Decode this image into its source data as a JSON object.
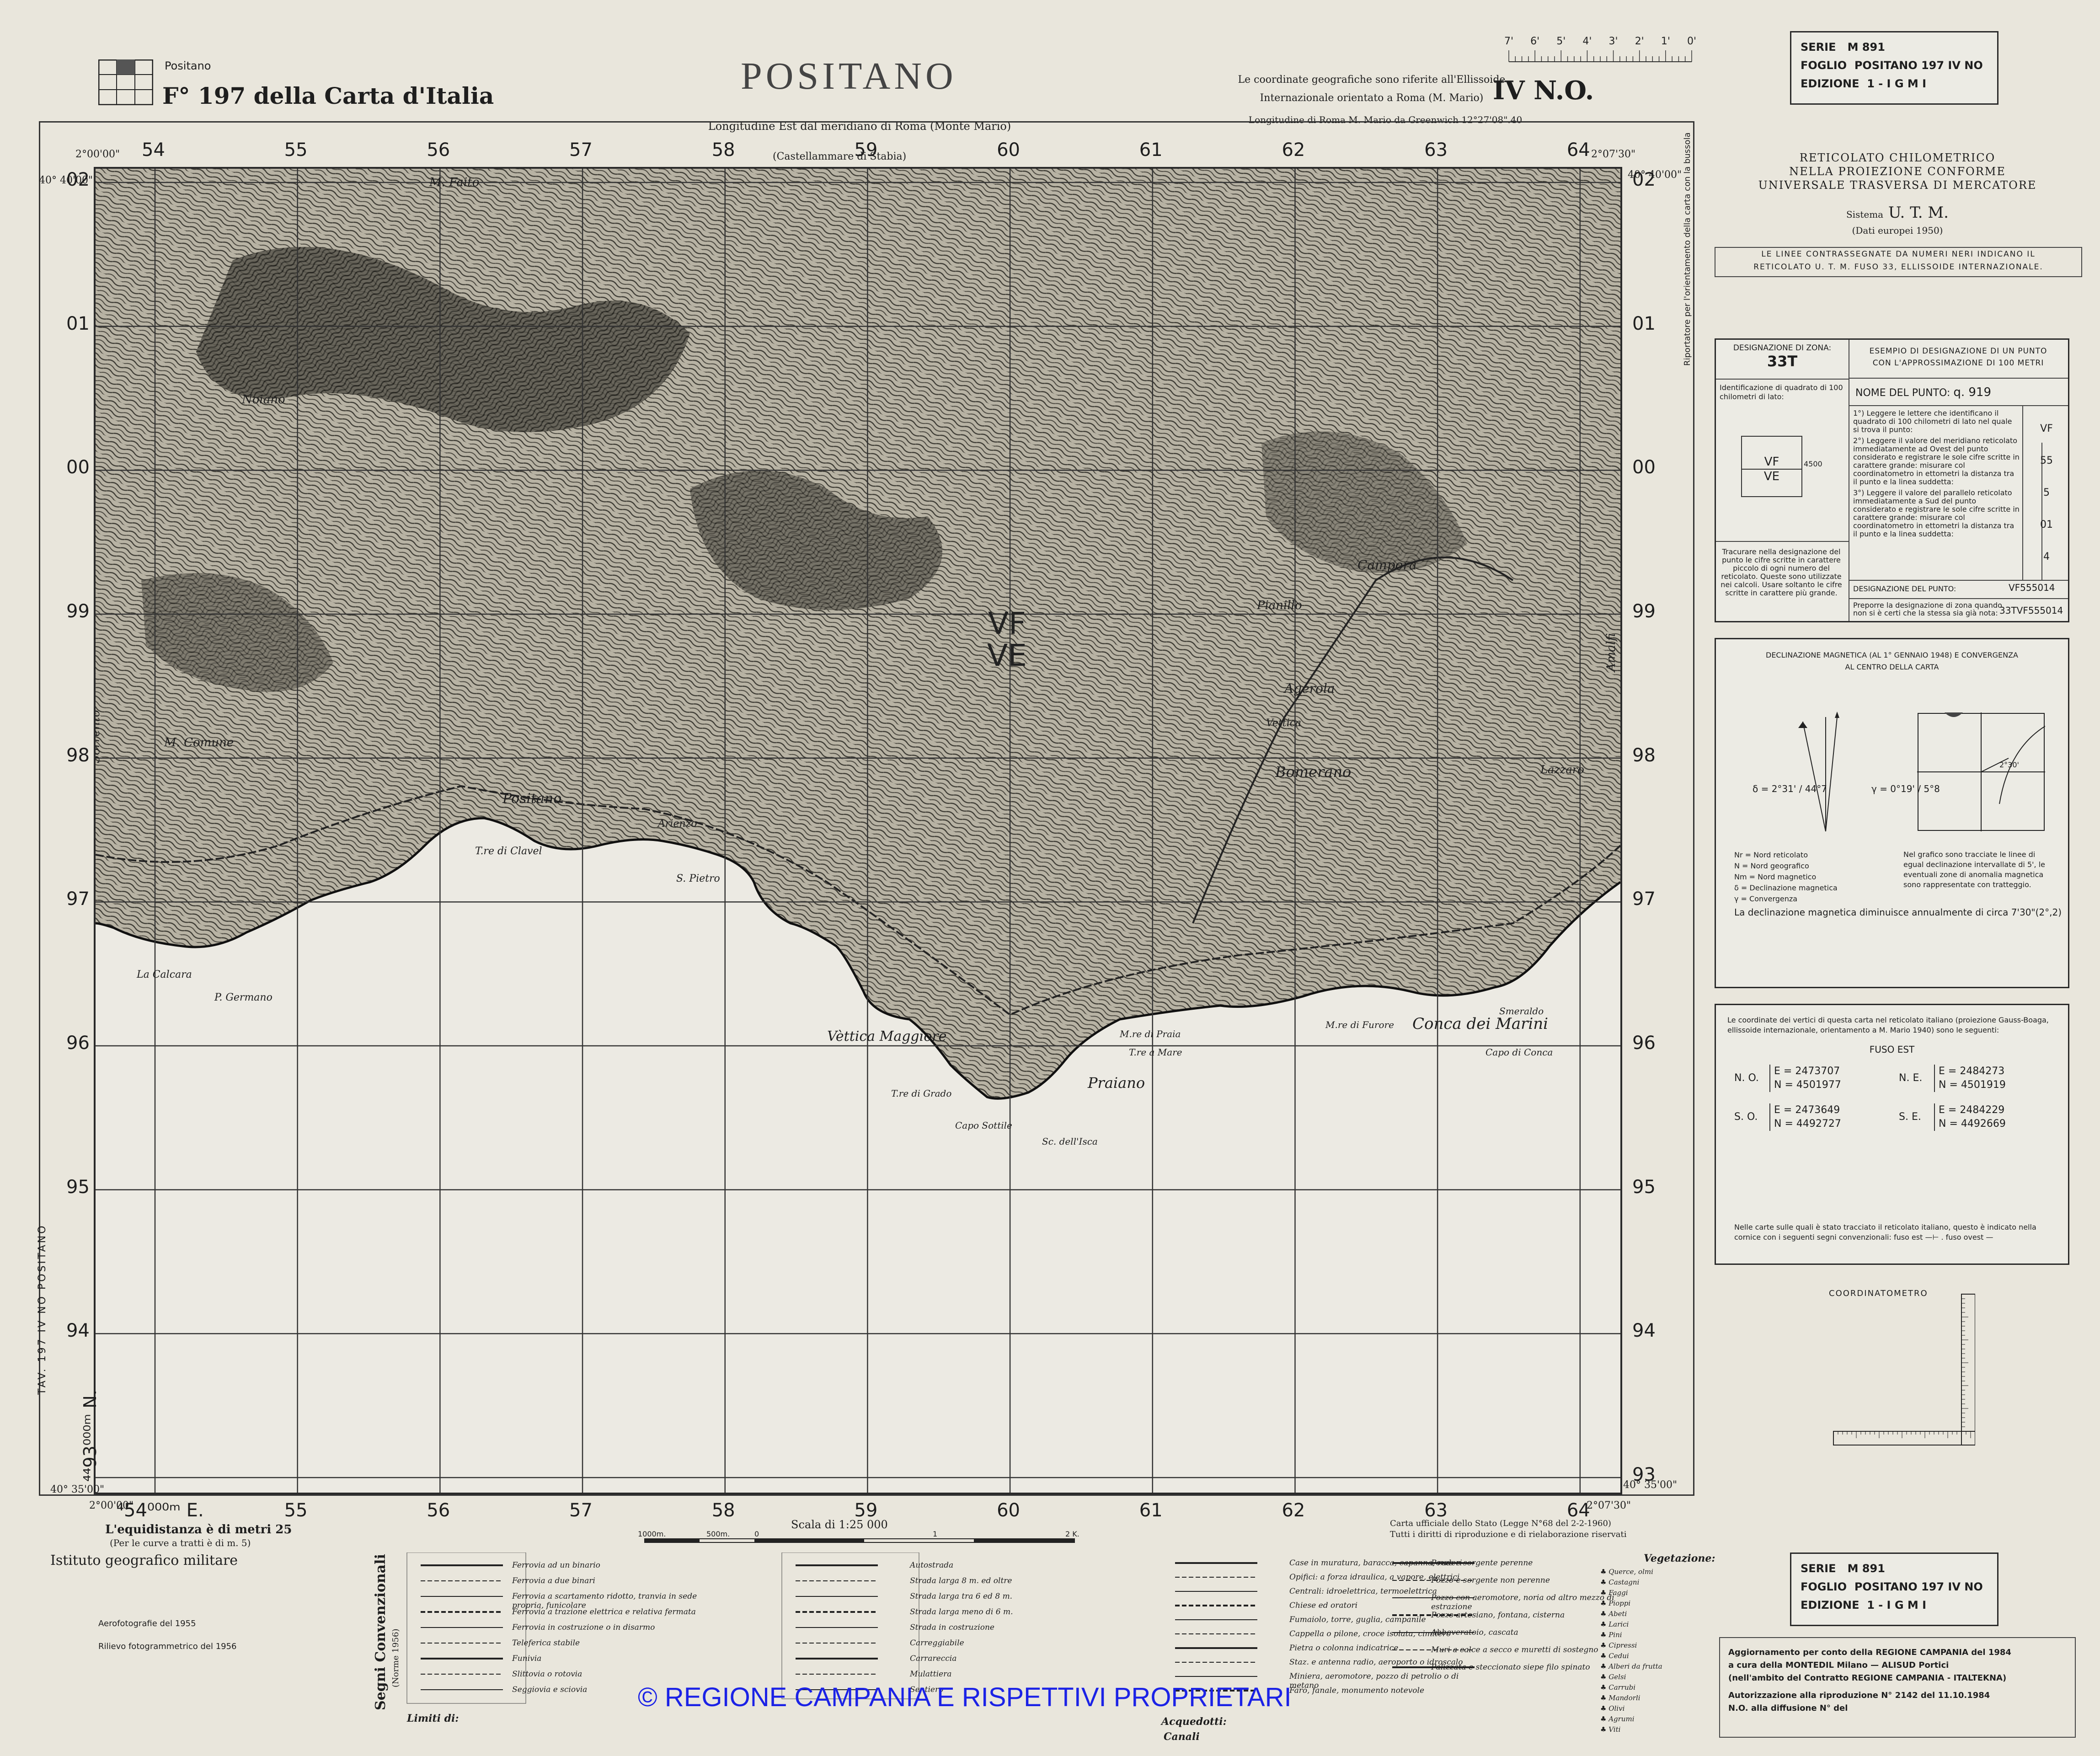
{
  "header": {
    "sheet_title": "POSITANO",
    "sheet_ref": "F° 197 della Carta d'Italia",
    "place_small": "Positano",
    "ellipsoid_line1": "Le coordinate geografiche sono riferite all'Ellissoide",
    "ellipsoid_line2": "Internazionale orientato a Roma (M. Mario)",
    "quadrant": "IV N.O.",
    "lon_rome": "Longitudine Est dal meridiano di Roma (Monte Mario)",
    "lon_greenwich": "Longitudine di Roma M. Mario da Greenwich 12°27'08\".40",
    "castellammare": "(Castellammare di Stabia)",
    "minute_labels": [
      "7'",
      "6'",
      "5'",
      "4'",
      "3'",
      "2'",
      "1'",
      "0'"
    ]
  },
  "serie_box": {
    "serie_label": "SERIE",
    "serie_value": "M 891",
    "foglio_label": "FOGLIO",
    "foglio_value": "POSITANO 197 IV NO",
    "edizione_label": "EDIZIONE",
    "edizione_value": "1 - I G M I"
  },
  "corners": {
    "top_left_lon": "2°00'00\"",
    "top_left_lat": "40° 40'00\"",
    "top_right_lon": "2°07'30\"",
    "top_right_lat": "40° 40'00\"",
    "bottom_left_lon": "2°00'00\"",
    "bottom_left_lat": "40° 35'00\"",
    "bottom_right_lon": "2°07'30\"",
    "bottom_right_lat": "40° 35'00\"",
    "easting_label": "⁴54⁰⁰⁰ᵐ E.",
    "northing_label": "⁴⁴93⁰⁰⁰ᵐ N."
  },
  "grid": {
    "top_ticks": [
      "54",
      "55",
      "56",
      "57",
      "58",
      "59",
      "60",
      "61",
      "62",
      "63",
      "64"
    ],
    "bottom_ticks": [
      "55",
      "56",
      "57",
      "58",
      "59",
      "60",
      "61",
      "62",
      "63",
      "64"
    ],
    "left_ticks": [
      "02",
      "01",
      "00",
      "99",
      "98",
      "97",
      "96",
      "95",
      "94"
    ],
    "right_ticks": [
      "02",
      "01",
      "00",
      "99",
      "98",
      "97",
      "96",
      "95",
      "94",
      "93"
    ],
    "zone_top": "VF",
    "zone_bottom": "VE"
  },
  "places": [
    {
      "name": "M. Faito",
      "size": 26
    },
    {
      "name": "M. Comune",
      "size": 26
    },
    {
      "name": "Positano",
      "size": 30
    },
    {
      "name": "T.re di Clavel",
      "size": 22
    },
    {
      "name": "Arienzo",
      "size": 22
    },
    {
      "name": "S. Pietro",
      "size": 22
    },
    {
      "name": "La Calcara",
      "size": 22
    },
    {
      "name": "P. Germano",
      "size": 22
    },
    {
      "name": "Vèttica Maggiore",
      "size": 30
    },
    {
      "name": "Praiano",
      "size": 32
    },
    {
      "name": "T.re di Grado",
      "size": 20
    },
    {
      "name": "Capo Sottile",
      "size": 20
    },
    {
      "name": "Sc. dell'Isca",
      "size": 20
    },
    {
      "name": "M.re di Praia",
      "size": 20
    },
    {
      "name": "T.re a Mare",
      "size": 20
    },
    {
      "name": "M.re di Furore",
      "size": 20
    },
    {
      "name": "Conca dei Marini",
      "size": 34
    },
    {
      "name": "Capo di Conca",
      "size": 20
    },
    {
      "name": "Smeraldo",
      "size": 20
    },
    {
      "name": "Amalfi",
      "size": 26
    },
    {
      "name": "Sorrento",
      "size": 26
    },
    {
      "name": "Agerola",
      "size": 28
    },
    {
      "name": "Bomerano",
      "size": 32
    },
    {
      "name": "Campora",
      "size": 28
    },
    {
      "name": "Pianillo",
      "size": 26
    },
    {
      "name": "Lazzaro",
      "size": 24
    },
    {
      "name": "Vettica",
      "size": 22
    },
    {
      "name": "Noiano",
      "size": 26
    }
  ],
  "side_text": {
    "left": "TAV. 197 IV NO POSITANO",
    "right": "Riportatore per l'orientamento della carta con la bussola"
  },
  "panel": {
    "reticolato_lines": [
      "RETICOLATO CHILOMETRICO",
      "NELLA PROIEZIONE CONFORME",
      "UNIVERSALE TRASVERSA DI MERCATORE"
    ],
    "sistema_label": "Sistema",
    "sistema_value": "U. T. M.",
    "dati_europei": "(Dati europei 1950)",
    "linee_line1": "LE LINEE CONTRASSEGNATE DA NUMERI NERI INDICANO IL",
    "linee_line2": "RETICOLATO U. T. M. FUSO 33, ELLISSOIDE INTERNAZIONALE.",
    "designation": {
      "zone_header": "DESIGNAZIONE DI ZONA:",
      "zone_value": "33T",
      "example_header1": "ESEMPIO DI DESIGNAZIONE DI UN PUNTO",
      "example_header2": "CON L'APPROSSIMAZIONE DI 100 METRI",
      "id_quadrato": "Identificazione di quadrato di 100 chilometri di lato:",
      "nome_punto_label": "NOME DEL PUNTO:",
      "nome_punto_value": "q. 919",
      "grid_vf": "VF",
      "grid_ve": "VE",
      "grid_4500": "4500",
      "steps": [
        "1°) Leggere le lettere che identificano il quadrato di 100 chilometri di lato nel quale si trova il punto:",
        "2°) Leggere il valore del meridiano reticolato immediatamente ad Ovest del punto considerato e registrare le sole cifre scritte in carattere grande: misurare col coordinatometro in ettometri la distanza tra il punto e la linea suddetta:",
        "3°) Leggere il valore del parallelo reticolato immediatamente a Sud del punto considerato e registrare le sole cifre scritte in carattere grande: misurare col coordinatometro in ettometri la distanza tra il punto e la linea suddetta:"
      ],
      "values": [
        "VF",
        "55",
        "5",
        "01",
        "4"
      ],
      "tracciare": "Tracurare nella designazione del punto le cifre scritte in carattere piccolo di ogni numero del reticolato. Queste sono utilizzate nei calcoli. Usare soltanto le cifre scritte in carattere più grande.",
      "designazione_label": "DESIGNAZIONE DEL PUNTO:",
      "designazione_value": "VF555014",
      "preporre": "Preporre la designazione di zona quando non si è certi che la stessa sia già nota:",
      "preporre_value": "33TVF555014"
    },
    "declination": {
      "title1": "DECLINAZIONE MAGNETICA (AL 1° GENNAIO 1948) E CONVERGENZA",
      "title2": "AL CENTRO DELLA CARTA",
      "delta": "δ = 2°31' / 44°7",
      "gamma": "γ = 0°19' / 5°8",
      "angle_label": "2°30'",
      "legend_nr": "Nr = Nord reticolato",
      "legend_n": "N = Nord geografico",
      "legend_nm": "Nm = Nord magnetico",
      "legend_d": "δ = Declinazione magnetica",
      "legend_g": "γ = Convergenza",
      "note": "Nel grafico sono tracciate le linee di egual declinazione intervallate di 5', le eventuali zone di anomalia magnetica sono rappresentate con tratteggio.",
      "annual": "La declinazione magnetica diminuisce annualmente di circa 7'30\"(2°,2)"
    },
    "coordinates": {
      "intro": "Le coordinate dei vertici di questa carta nel reticolato italiano (proiezione Gauss-Boaga, ellissoide internazionale, orientamento a M. Mario 1940) sono le seguenti:",
      "fuso": "FUSO EST",
      "no_label": "N. O.",
      "no_e": "E = 2473707",
      "no_n": "N = 4501977",
      "ne_label": "N. E.",
      "ne_e": "E = 2484273",
      "ne_n": "N = 4501919",
      "so_label": "S. O.",
      "so_e": "E = 2473649",
      "so_n": "N = 4492727",
      "se_label": "S. E.",
      "se_e": "E = 2484229",
      "se_n": "N = 4492669",
      "footer": "Nelle carte sulle quali è stato tracciato il reticolato italiano, questo è indicato nella cornice con i seguenti segni convenzionali: fuso est —⊢ . fuso ovest —"
    },
    "coordinatometro": "COORDINATOMETRO"
  },
  "bottom": {
    "scale": "Scala di 1:25 000",
    "scale_labels": [
      "1000m.",
      "500m.",
      "0",
      "1",
      "2 K."
    ],
    "official1": "Carta ufficiale dello Stato (Legge N°68 del 2-2-1960)",
    "official2": "Tutti i diritti di riproduzione e di rielaborazione riservati",
    "equidistanza": "L'equidistanza è di metri 25",
    "equidistanza_sub": "(Per le curve a tratti è di m. 5)",
    "igm": "Istituto geografico militare",
    "aero": "Aerofotografie del 1955",
    "rilievo": "Rilievo fotogrammetrico del 1956",
    "segni_title": "Segni Convenzionali",
    "segni_sub": "(Norme 1956)",
    "limiti": "Limiti di:",
    "legend_items": [
      "Ferrovia ad un binario",
      "Ferrovia a due binari",
      "Ferrovia a scartamento ridotto, tranvia in sede propria, funicolare",
      "Ferrovia a trazione elettrica e relativa fermata",
      "Ferrovia in costruzione o in disarmo",
      "Teleferica stabile",
      "Funivia",
      "Slittovia o rotovia",
      "Seggiovia e sciovia",
      "Autostrada",
      "Strada larga 8 m. ed oltre",
      "Strada larga tra 6 ed 8 m.",
      "Strada larga meno di 6 m.",
      "Strada in costruzione",
      "Carreggiabile",
      "Carrareccia",
      "Mulattiera",
      "Sentiero",
      "Case in muratura, baracca, capanna, ruderi",
      "Opifici: a forza idraulica, a vapore, elettrici",
      "Centrali: idroelettrica, termoelettrica",
      "Chiese ed oratori",
      "Fumaiolo, torre, guglia, campanile",
      "Cappella o pilone, croce isolata, cimitero",
      "Pietra o colonna indicatrice",
      "Staz. e antenna radio, aeroporto o idroscalo",
      "Miniera, aeromotore, pozzo di petrolio o di metano",
      "Faro, fanale, monumento notevole",
      "Pozzo e sorgente perenne",
      "Pozzo e sorgente non perenne",
      "Pozzo con aeromotore, noria od altro mezzo di estrazione",
      "Pozzo artesiano, fontana, cisterna",
      "Abbeveratoio, cascata",
      "Muri a calce a secco e muretti di sostegno",
      "Palizzata e steccionato siepe filo spinato"
    ],
    "acquedotti": "Acquedotti:",
    "canali": "Canali",
    "vegetation_title": "Vegetazione:",
    "vegetation": [
      "Querce, olmi",
      "Castagni",
      "Faggi",
      "Pioppi",
      "Abeti",
      "Larici",
      "Pini",
      "Cipressi",
      "Cedui",
      "Alberi da frutta",
      "Gelsi",
      "Carrubi",
      "Mandorli",
      "Olivi",
      "Agrumi",
      "Viti"
    ],
    "update1": "Aggiornamento per conto della REGIONE CAMPANIA del 1984",
    "update2": "a cura della MONTEDIL Milano — ALISUD Portici",
    "update3": "(nell'ambito del Contratto REGIONE CAMPANIA - ITALTEKNA)",
    "update4": "Autorizzazione alla riproduzione N° 2142 del 11.10.1984",
    "update5": "N.O. alla diffusione N° del",
    "watermark": "© REGIONE CAMPANIA E RISPETTIVI PROPRIETARI"
  },
  "colors": {
    "paper": "#e9e6dc",
    "ink": "#1e1e1e",
    "watermark": "#1b22e6"
  }
}
